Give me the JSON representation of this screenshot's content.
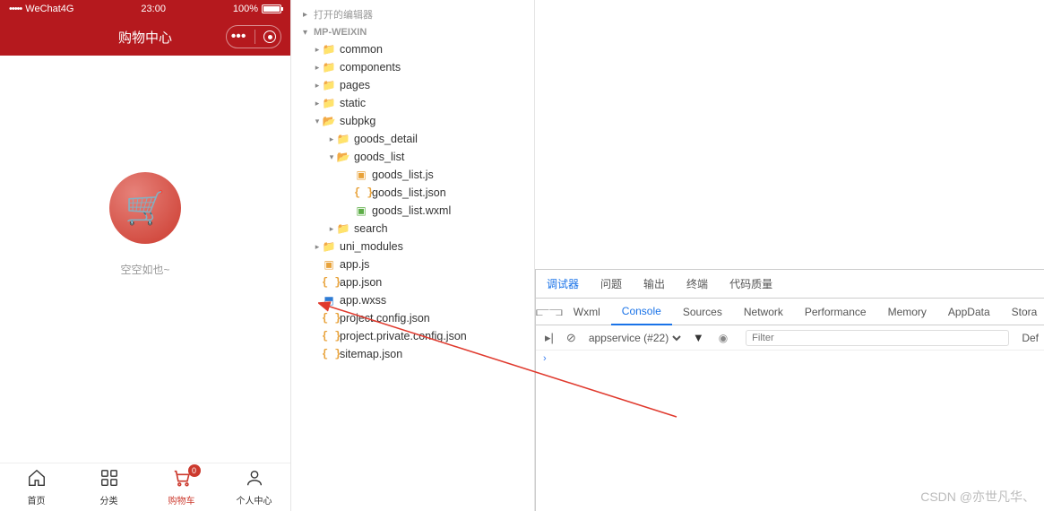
{
  "simulator": {
    "status": {
      "carrier": "WeChat4G",
      "time": "23:00",
      "battery": "100%"
    },
    "nav_title": "购物中心",
    "empty_text": "空空如也~",
    "tabs": [
      {
        "label": "首页",
        "icon": "⌂"
      },
      {
        "label": "分类",
        "icon": "▦"
      },
      {
        "label": "购物车",
        "icon": "🛒",
        "badge": "0",
        "active": true
      },
      {
        "label": "个人中心",
        "icon": "◉"
      }
    ]
  },
  "explorer": {
    "open_editors": "打开的编辑器",
    "project": "MP-WEIXIN",
    "tree": {
      "common": "common",
      "components": "components",
      "pages": "pages",
      "static": "static",
      "subpkg": "subpkg",
      "goods_detail": "goods_detail",
      "goods_list": "goods_list",
      "goods_list_js": "goods_list.js",
      "goods_list_json": "goods_list.json",
      "goods_list_wxml": "goods_list.wxml",
      "search": "search",
      "uni_modules": "uni_modules",
      "app_js": "app.js",
      "app_json": "app.json",
      "app_wxss": "app.wxss",
      "project_config": "project.config.json",
      "project_private": "project.private.config.json",
      "sitemap": "sitemap.json"
    }
  },
  "devtools": {
    "tabs1": [
      "调试器",
      "问题",
      "输出",
      "终端",
      "代码质量"
    ],
    "tabs2": [
      "Wxml",
      "Console",
      "Sources",
      "Network",
      "Performance",
      "Memory",
      "AppData",
      "Stora"
    ],
    "context": "appservice (#22)",
    "filter_placeholder": "Filter",
    "levels": "Def"
  },
  "watermark": "CSDN @亦世凡华、"
}
